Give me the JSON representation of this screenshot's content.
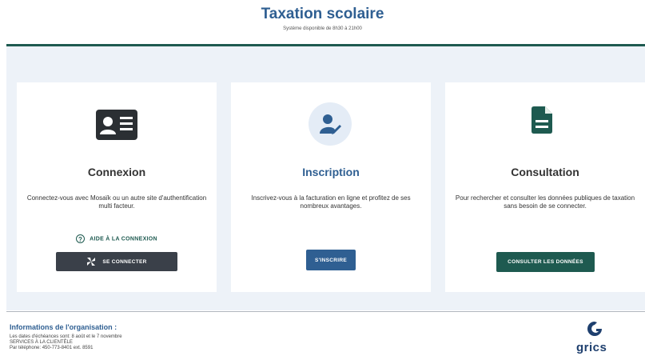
{
  "header": {
    "title": "Taxation scolaire",
    "subtitle": "Système disponible de 8h30 à 21h00"
  },
  "cards": [
    {
      "icon": "id-card-icon",
      "title": "Connexion",
      "description": "Connectez-vous avec Mosaïk ou un autre site d'authentification multi facteur.",
      "help_link": "AIDE À LA CONNEXION",
      "button": "SE CONNECTER"
    },
    {
      "icon": "user-edit-icon",
      "title": "Inscription",
      "description": "Inscrivez-vous à la facturation en ligne et profitez de ses nombreux avantages.",
      "button": "S'INSCRIRE"
    },
    {
      "icon": "document-icon",
      "title": "Consultation",
      "description": "Pour rechercher et consulter les données publiques de taxation sans besoin de se connecter.",
      "button": "CONSULTER LES DONNÉES"
    }
  ],
  "footer": {
    "title": "Informations de l'organisation :",
    "lines": [
      "Les dates d'échéances sont: 8 août et le 7 novembre",
      "SERVICES À LA CLIENTÈLE",
      "Par téléphone: 450-773-8401 ext. 8591"
    ],
    "logo_text": "grics"
  },
  "colors": {
    "brand_blue": "#2f5f92",
    "brand_green": "#1e5a50",
    "dark_button": "#3a4049",
    "background": "#edf2f8"
  }
}
